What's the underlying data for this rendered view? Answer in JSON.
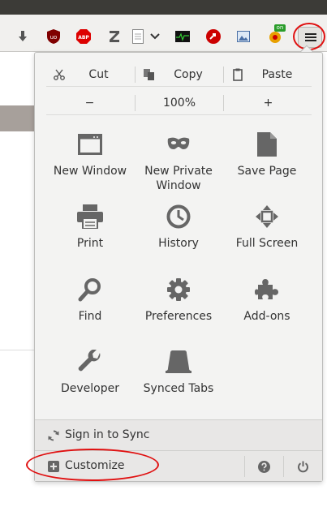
{
  "toolbar": {
    "icons": [
      "download-icon",
      "ublock-icon",
      "adblock-icon",
      "zotero-icon",
      "page-icon",
      "chevron-down-icon",
      "activity-icon",
      "flashgot-icon",
      "image-icon",
      "extension-badge-icon",
      "hamburger-menu-icon"
    ],
    "badge_text": "on"
  },
  "menu": {
    "edit": {
      "cut": "Cut",
      "copy": "Copy",
      "paste": "Paste"
    },
    "zoom": {
      "out": "−",
      "level": "100%",
      "in": "+"
    },
    "items": [
      {
        "label": "New Window",
        "icon": "window-icon"
      },
      {
        "label": "New Private Window",
        "icon": "mask-icon"
      },
      {
        "label": "Save Page",
        "icon": "page-save-icon"
      },
      {
        "label": "Print",
        "icon": "printer-icon"
      },
      {
        "label": "History",
        "icon": "clock-icon"
      },
      {
        "label": "Full Screen",
        "icon": "fullscreen-icon"
      },
      {
        "label": "Find",
        "icon": "magnifier-icon"
      },
      {
        "label": "Preferences",
        "icon": "gear-icon"
      },
      {
        "label": "Add-ons",
        "icon": "puzzle-icon"
      },
      {
        "label": "Developer",
        "icon": "wrench-icon"
      },
      {
        "label": "Synced Tabs",
        "icon": "synced-tabs-icon"
      }
    ],
    "sync_label": "Sign in to Sync",
    "customize_label": "Customize"
  },
  "colors": {
    "highlight_ring": "#e01010",
    "panel_bg": "#f3f3f2",
    "footer_bg": "#e8e7e6",
    "icon_gray": "#666666"
  }
}
